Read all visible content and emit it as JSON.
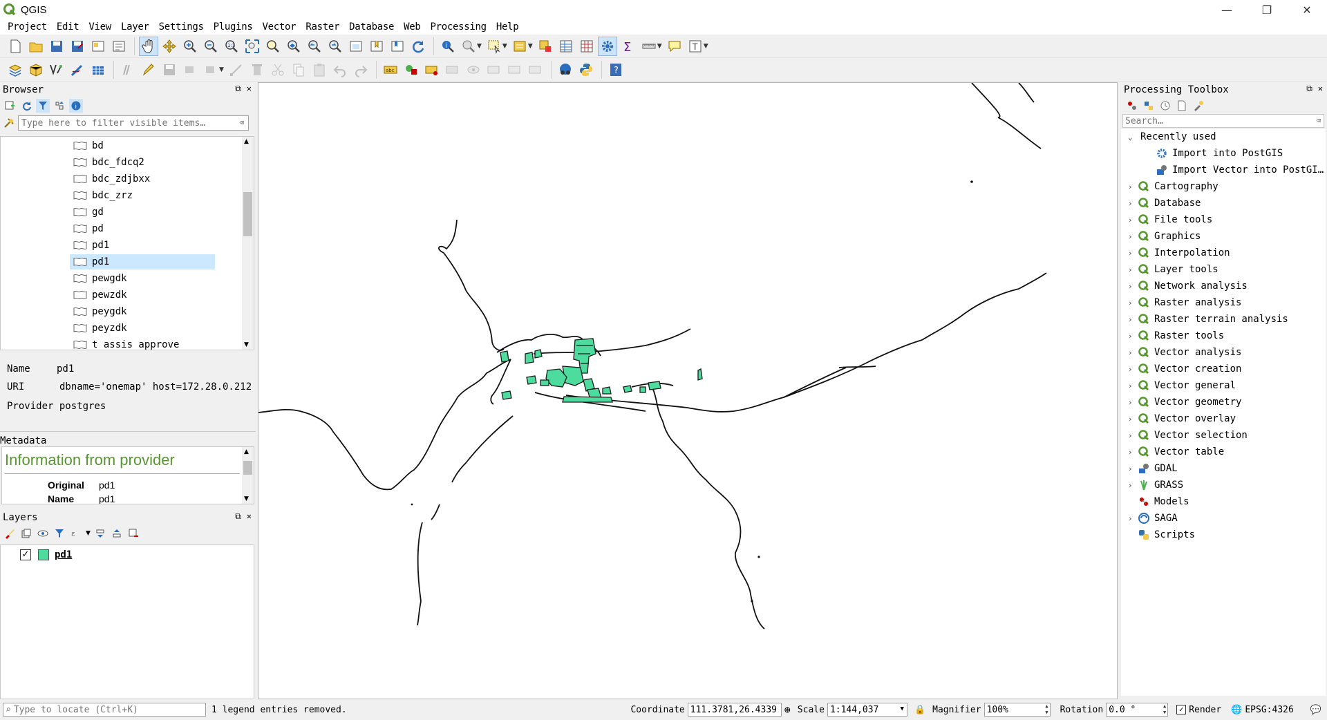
{
  "window": {
    "title": "QGIS",
    "minimize": "—",
    "restore": "❐",
    "close": "✕"
  },
  "menu": [
    "Project",
    "Edit",
    "View",
    "Layer",
    "Settings",
    "Plugins",
    "Vector",
    "Raster",
    "Database",
    "Web",
    "Processing",
    "Help"
  ],
  "browser": {
    "title": "Browser",
    "filter_placeholder": "Type here to filter visible items…",
    "items": [
      "bd",
      "bdc_fdcq2",
      "bdc_zdjbxx",
      "bdc_zrz",
      "gd",
      "pd",
      "pd1",
      "pd1",
      "pewgdk",
      "pewzdk",
      "peygdk",
      "peyzdk",
      "t_assis_approve"
    ],
    "selected_index": 7
  },
  "info": {
    "name_key": "Name",
    "name_value": "pd1",
    "uri_key": "URI",
    "uri_value": "dbname='onemap' host=172.28.0.212",
    "provider_text": "Provider postgres"
  },
  "metadata": {
    "title": "Metadata",
    "heading": "Information from provider",
    "original_key": "Original",
    "original_value": "pd1",
    "name_key": "Name",
    "name_value": "pd1"
  },
  "layers": {
    "title": "Layers",
    "items": [
      {
        "name": "pd1",
        "checked": "✓",
        "color": "#4ddc9d"
      }
    ]
  },
  "toolbox": {
    "title": "Processing Toolbox",
    "search_placeholder": "Search…",
    "recent_label": "Recently used",
    "recent": [
      "Import into PostGIS",
      "Import Vector into PostGI…"
    ],
    "groups": [
      "Cartography",
      "Database",
      "File tools",
      "Graphics",
      "Interpolation",
      "Layer tools",
      "Network analysis",
      "Raster analysis",
      "Raster terrain analysis",
      "Raster tools",
      "Vector analysis",
      "Vector creation",
      "Vector general",
      "Vector geometry",
      "Vector overlay",
      "Vector selection",
      "Vector table"
    ],
    "providers": [
      "GDAL",
      "GRASS",
      "Models",
      "SAGA",
      "Scripts"
    ]
  },
  "status": {
    "locate_placeholder": "Type to locate (Ctrl+K)",
    "message": "1 legend entries removed.",
    "coordinate_label": "Coordinate",
    "coordinate_value": "111.3781,26.4339",
    "scale_label": "Scale",
    "scale_value": "1:144,037",
    "magnifier_label": "Magnifier",
    "magnifier_value": "100%",
    "rotation_label": "Rotation",
    "rotation_value": "0.0 °",
    "render_label": "Render",
    "crs": "EPSG:4326"
  },
  "colors": {
    "accent": "#589632",
    "feature_fill": "#4ddc9d",
    "selection": "#cce8ff"
  }
}
